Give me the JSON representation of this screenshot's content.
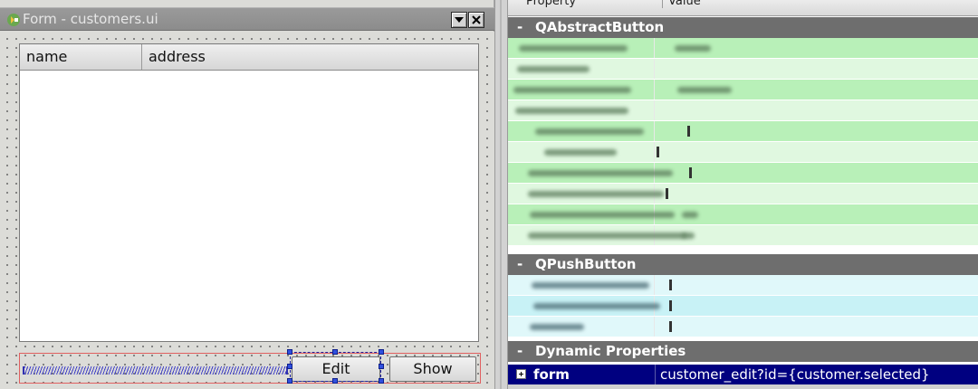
{
  "form_window": {
    "title": "Form - customers.ui",
    "table": {
      "columns": [
        "name",
        "address"
      ]
    },
    "buttons": {
      "edit_label": "Edit",
      "show_label": "Show"
    }
  },
  "property_editor": {
    "header": {
      "property": "Property",
      "value": "Value"
    },
    "groups": [
      {
        "toggle": "-",
        "label": "QAbstractButton",
        "color": "#b8f0b8"
      },
      {
        "toggle": "-",
        "label": "QPushButton",
        "color": "#c8f2f6"
      },
      {
        "toggle": "-",
        "label": "Dynamic Properties"
      }
    ],
    "dynamic_property": {
      "name": "form",
      "value": "customer_edit?id={customer.selected}"
    }
  },
  "colors": {
    "selection": "#000080",
    "group_header": "#6e6e6e",
    "green_light": "#e0f8e0",
    "green": "#b8f0b8",
    "cyan_light": "#e0f8fa",
    "cyan": "#c8f2f6"
  },
  "icons": [
    "qt-designer-icon",
    "minimize-icon",
    "close-icon",
    "expand-icon"
  ]
}
